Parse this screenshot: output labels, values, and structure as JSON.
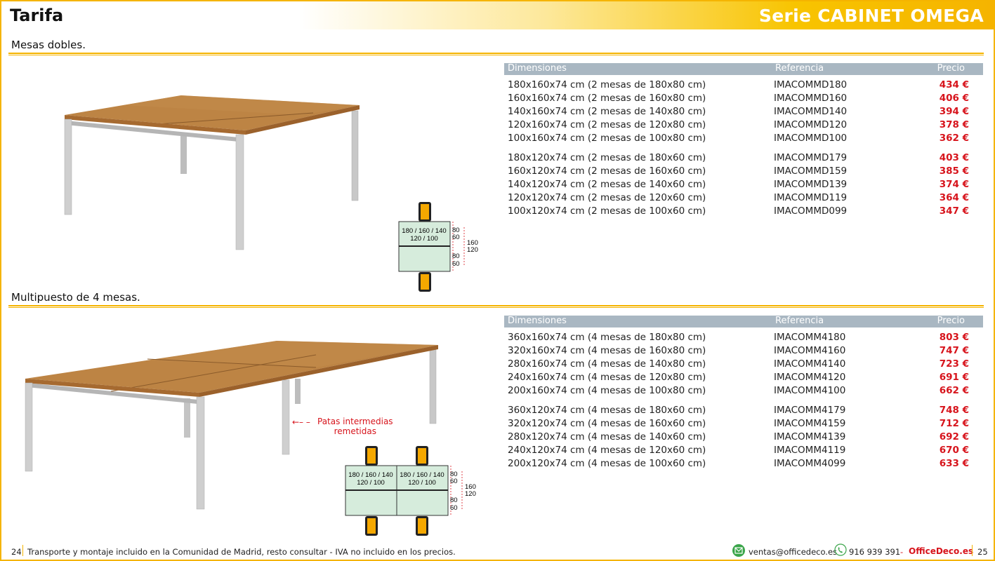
{
  "header": {
    "title": "Tarifa",
    "series": "Serie CABINET OMEGA"
  },
  "section1": {
    "title": "Mesas dobles.",
    "columns": {
      "dim": "Dimensiones",
      "ref": "Referencia",
      "price": "Precio"
    },
    "rows": [
      {
        "dim": "180x160x74 cm (2 mesas de 180x80 cm)",
        "ref": "IMACOMMD180",
        "price": "434 €"
      },
      {
        "dim": "160x160x74 cm (2 mesas de 160x80 cm)",
        "ref": "IMACOMMD160",
        "price": "406 €"
      },
      {
        "dim": "140x160x74 cm (2 mesas de 140x80 cm)",
        "ref": "IMACOMMD140",
        "price": "394 €"
      },
      {
        "dim": "120x160x74 cm (2 mesas de 120x80 cm)",
        "ref": "IMACOMMD120",
        "price": "378 €"
      },
      {
        "dim": "100x160x74 cm (2 mesas de 100x80 cm)",
        "ref": "IMACOMMD100",
        "price": "362 €"
      },
      {
        "dim": "180x120x74 cm (2 mesas de 180x60 cm)",
        "ref": "IMACOMMD179",
        "price": "403 €"
      },
      {
        "dim": "160x120x74 cm (2 mesas de 160x60 cm)",
        "ref": "IMACOMMD159",
        "price": "385 €"
      },
      {
        "dim": "140x120x74 cm (2 mesas de 140x60 cm)",
        "ref": "IMACOMMD139",
        "price": "374 €"
      },
      {
        "dim": "120x120x74 cm (2 mesas de 120x60 cm)",
        "ref": "IMACOMMD119",
        "price": "364 €"
      },
      {
        "dim": "100x120x74 cm (2 mesas de 100x60 cm)",
        "ref": "IMACOMMD099",
        "price": "347 €"
      }
    ],
    "diagram": {
      "top_label_1": "180 / 160 / 140",
      "top_label_2": "120 / 100",
      "depth_a1": "80",
      "depth_a2": "60",
      "depth_b1": "80",
      "depth_b2": "60",
      "total_1": "160",
      "total_2": "120"
    }
  },
  "section2": {
    "title": "Multipuesto de 4 mesas.",
    "columns": {
      "dim": "Dimensiones",
      "ref": "Referencia",
      "price": "Precio"
    },
    "rows": [
      {
        "dim": "360x160x74 cm (4 mesas de 180x80 cm)",
        "ref": "IMACOMM4180",
        "price": "803 €"
      },
      {
        "dim": "320x160x74 cm (4 mesas de 160x80 cm)",
        "ref": "IMACOMM4160",
        "price": "747 €"
      },
      {
        "dim": "280x160x74 cm (4 mesas de 140x80 cm)",
        "ref": "IMACOMM4140",
        "price": "723 €"
      },
      {
        "dim": "240x160x74 cm (4 mesas de 120x80 cm)",
        "ref": "IMACOMM4120",
        "price": "691 €"
      },
      {
        "dim": "200x160x74 cm (4 mesas de 100x80 cm)",
        "ref": "IMACOMM4100",
        "price": "662 €"
      },
      {
        "dim": "360x120x74 cm (4 mesas de 180x60 cm)",
        "ref": "IMACOMM4179",
        "price": "748 €"
      },
      {
        "dim": "320x120x74 cm (4 mesas de 160x60 cm)",
        "ref": "IMACOMM4159",
        "price": "712 €"
      },
      {
        "dim": "280x120x74 cm (4 mesas de 140x60 cm)",
        "ref": "IMACOMM4139",
        "price": "692 €"
      },
      {
        "dim": "240x120x74 cm (4 mesas de 120x60 cm)",
        "ref": "IMACOMM4119",
        "price": "670 €"
      },
      {
        "dim": "200x120x74 cm (4 mesas de 100x60 cm)",
        "ref": "IMACOMM4099",
        "price": "633 €"
      }
    ],
    "callout": {
      "line1": "Patas intermedias",
      "line2": "remetidas"
    },
    "diagram": {
      "top_label_1": "180 / 160 / 140",
      "top_label_2": "120 / 100",
      "depth_a1": "80",
      "depth_a2": "60",
      "depth_b1": "80",
      "depth_b2": "60",
      "total_1": "160",
      "total_2": "120"
    }
  },
  "footer": {
    "page_left": "24",
    "note": "Transporte y montaje incluido en la Comunidad de Madrid, resto consultar - IVA no incluido en los precios.",
    "email": "ventas@officedeco.es",
    "phone": "916 939 391",
    "dash": "-",
    "brand": "OfficeDeco.es",
    "page_right": "25"
  },
  "colors": {
    "accent": "#f5b400",
    "price": "#d7141c",
    "header_bar": "#a9b7c2",
    "wood": "#b87a3e",
    "leg": "#c8c8c8",
    "plan_fill": "#d6ecdc"
  }
}
